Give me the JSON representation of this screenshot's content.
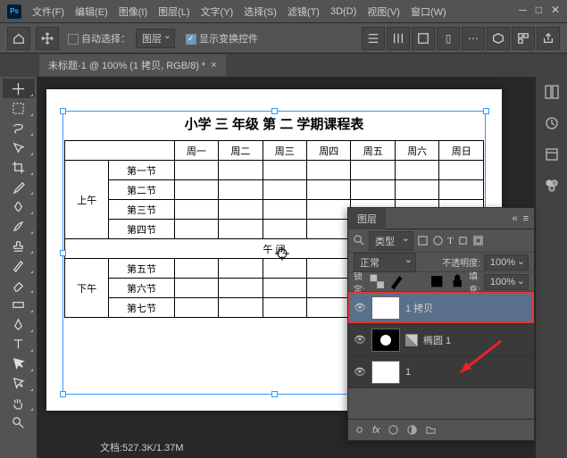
{
  "menu": {
    "file": "文件(F)",
    "edit": "编辑(E)",
    "image": "图像(I)",
    "layer": "图层(L)",
    "type": "文字(Y)",
    "select": "选择(S)",
    "filter": "滤镜(T)",
    "threed": "3D(D)",
    "view": "视图(V)",
    "window": "窗口(W)"
  },
  "options": {
    "auto_select": "自动选择：",
    "layer_dd": "图层",
    "show_transform": "显示变换控件"
  },
  "doc_tab": "未标题-1 @ 100% (1 拷贝, RGB/8) *",
  "schedule": {
    "title": "小学 三 年级 第 二 学期课程表",
    "days": [
      "周一",
      "周二",
      "周三",
      "周四",
      "周五",
      "周六",
      "周日"
    ],
    "am": "上午",
    "pm": "下午",
    "noon": "午 间",
    "p1": "第一节",
    "p2": "第二节",
    "p3": "第三节",
    "p4": "第四节",
    "p5": "第五节",
    "p6": "第六节",
    "p7": "第七节"
  },
  "status": "文档:527.3K/1.37M",
  "layers": {
    "panel": "图层",
    "filter": "类型",
    "blend": "正常",
    "opacity_l": "不透明度:",
    "opacity_v": "100%",
    "lock": "锁定:",
    "fill_l": "填充:",
    "fill_v": "100%",
    "items": [
      {
        "name": "1 拷贝"
      },
      {
        "name": "椭圆 1"
      },
      {
        "name": "1"
      }
    ]
  }
}
